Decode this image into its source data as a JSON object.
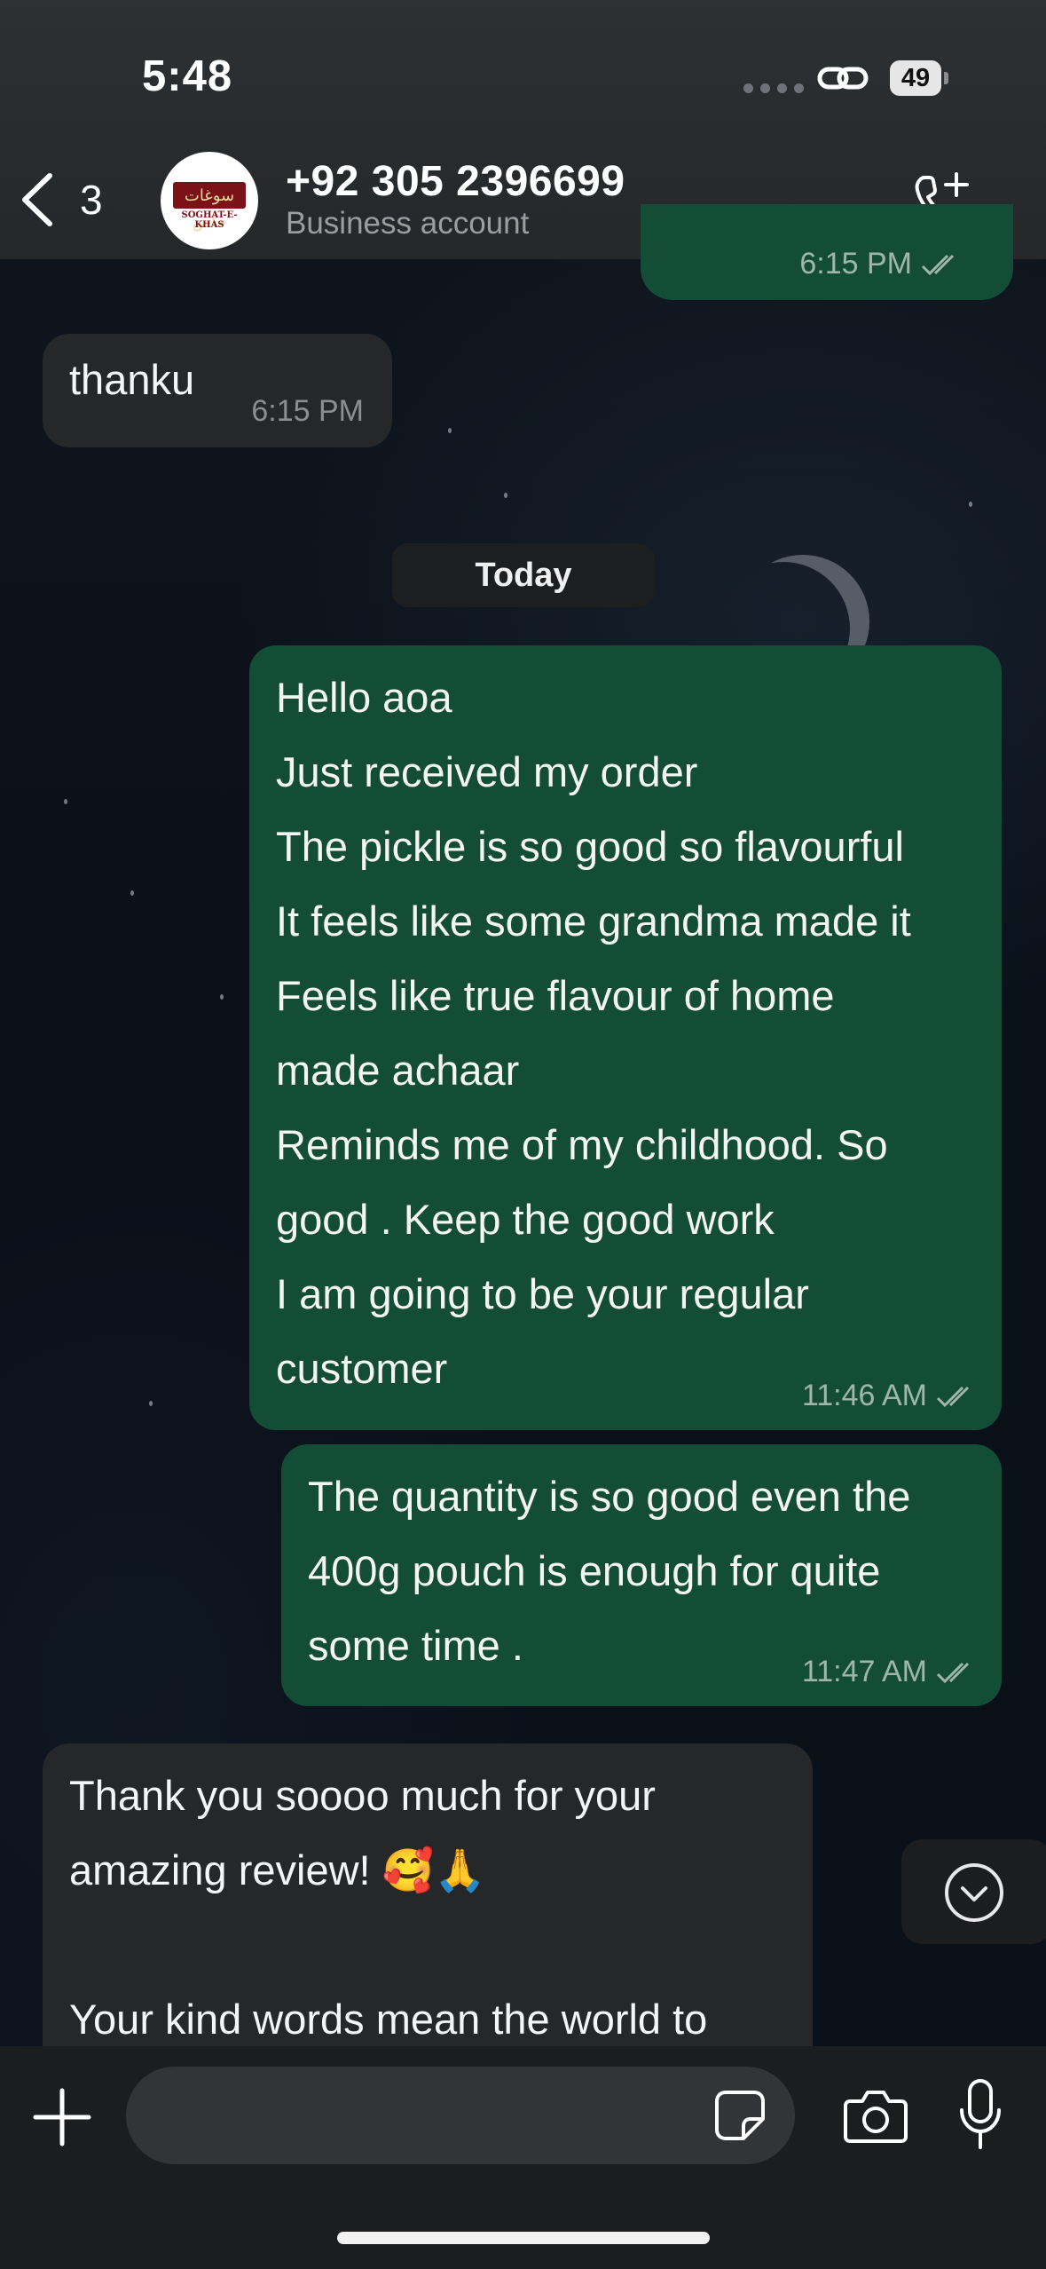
{
  "status_bar": {
    "time": "5:48",
    "battery": "49"
  },
  "header": {
    "back_count": "3",
    "contact_name": "+92 305 2396699",
    "contact_subtitle": "Business account",
    "avatar_logo_text": "SOGHAT-E-KHAS",
    "avatar_logo_urdu": "سوغات خاص"
  },
  "messages": [
    {
      "direction": "out",
      "time": "6:15 PM",
      "partial": true
    },
    {
      "direction": "in",
      "text": "thanku",
      "time": "6:15 PM"
    },
    {
      "direction": "out",
      "text": "Hello aoa\nJust received my order\nThe pickle is so good so flavourful\nIt feels like some grandma made it\nFeels like true flavour of home\nmade achaar\nReminds me of my childhood. So\ngood . Keep the good work\nI am going to be your regular\ncustomer",
      "time": "11:46 AM"
    },
    {
      "direction": "out",
      "text": "The quantity is so good even the\n400g pouch is enough for quite\nsome time .",
      "time": "11:47 AM"
    },
    {
      "direction": "in",
      "text": "Thank you soooo much for your\namazing review! 🥰🙏\n\nYour kind words mean the world to",
      "partial": true
    }
  ],
  "date_separator": "Today",
  "input": {
    "placeholder": ""
  },
  "icons": {
    "back": "chevron-left-icon",
    "call": "phone-add-icon",
    "scroll": "chevron-down-circle-icon",
    "attach": "plus-icon",
    "sticker": "sticker-icon",
    "camera": "camera-icon",
    "mic": "microphone-icon"
  },
  "colors": {
    "outgoing_bubble": "#144d37",
    "incoming_bubble": "#262729",
    "read_ticks": "#9fb6aa"
  }
}
